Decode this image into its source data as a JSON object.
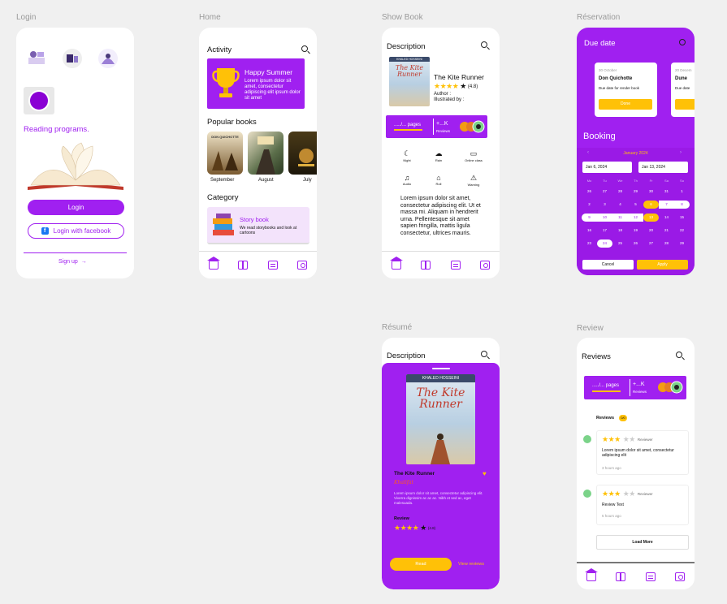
{
  "labels": {
    "login": "Login",
    "home": "Home",
    "show_book": "Show Book",
    "reservation": "Réservation",
    "resume": "Résumé",
    "review": "Review"
  },
  "login_screen": {
    "reading_programs": "Reading programs.",
    "login_button": "Login",
    "facebook_button": "Login with facebook",
    "signup": "Sign up"
  },
  "home_screen": {
    "activity": "Activity",
    "banner_title": "Happy Summer",
    "banner_text": "Lorem ipsum dolor sit amet, consectetur adipiscing elit ipsum dolor sit amet",
    "popular": "Popular books",
    "books": [
      {
        "month": "September",
        "cover": "DON QUICHOTTE"
      },
      {
        "month": "August",
        "cover": ""
      },
      {
        "month": "July",
        "cover": ""
      }
    ],
    "category": "Category",
    "category_title": "Story book",
    "category_text": "We read storybooks and look at cartoons"
  },
  "show_book": {
    "description": "Description",
    "cover_author": "KHALED HOSSEINI",
    "cover_title": "The Kite Runner",
    "title": "The Kite Runner",
    "rating": "(4.8)",
    "author": "Author :",
    "illustrated": "Illustrated by :",
    "pages": "...../... pages",
    "reviews_count": "+...K",
    "reviews_label": "Reviews",
    "features": [
      {
        "icon": "night-icon",
        "label": "Night"
      },
      {
        "icon": "rain-icon",
        "label": "Rain"
      },
      {
        "icon": "laptop-icon",
        "label": "Online class"
      },
      {
        "icon": "audio-icon",
        "label": "Audio"
      },
      {
        "icon": "building-icon",
        "label": "Roll"
      },
      {
        "icon": "warning-icon",
        "label": "Warning"
      }
    ],
    "body": "Lorem ipsum dolor sit amet, consectetur adipiscing elit. Ut et massa mi. Aliquam in hendrerit urna. Pellentesque sit amet sapien fringilla, mattis ligula consectetur, ultrices mauris."
  },
  "reservation": {
    "due_date": "Due date",
    "cards": [
      {
        "date": "30 October",
        "title": "Don Quichotte",
        "sub": "Due date for render book",
        "button": "Done"
      },
      {
        "date": "20 Decem",
        "title": "Dune",
        "sub": "Due date",
        "button": ""
      }
    ],
    "booking": "Booking",
    "month": "January 2024",
    "from": "Jan 6, 2024",
    "to": "Jan 13, 2024",
    "weekdays": [
      "Mo",
      "Tu",
      "We",
      "Th",
      "Fr",
      "Sa",
      "Su"
    ],
    "weeks": [
      [
        "26",
        "27",
        "28",
        "29",
        "30",
        "31",
        "1"
      ],
      [
        "2",
        "3",
        "4",
        "5",
        "6",
        "7",
        "8"
      ],
      [
        "9",
        "10",
        "11",
        "12",
        "13",
        "14",
        "15"
      ],
      [
        "16",
        "17",
        "18",
        "19",
        "20",
        "21",
        "22"
      ],
      [
        "23",
        "24",
        "25",
        "26",
        "27",
        "28",
        "29"
      ]
    ],
    "cancel": "Cancel",
    "apply": "Apply"
  },
  "resume": {
    "description": "Description",
    "cover_author": "KHALED HOSSEINI",
    "cover_title": "The Kite Runner",
    "title": "The Kite Runner",
    "author_tag": "Khalifat",
    "body": "Lorem ipsum dolor sit amet, consectetur adipiscing elit. Viverra dignissim ac ac ac. Nibh et sed ac, eget malesuada.",
    "review": "Review",
    "rating": "(4.8)",
    "read": "Read",
    "view_reviews": "View reviews"
  },
  "review_screen": {
    "reviews": "Reviews",
    "pages": "...../... pages",
    "reviews_count": "+...K",
    "reviews_label": "Reviews",
    "count_label": "Reviews",
    "count_badge": "0/0",
    "items": [
      {
        "reviewer": "Reviewer",
        "text": "Lorem ipsum dolor sit amet, consectetur adipiscing elit",
        "time": "3 hours ago"
      },
      {
        "reviewer": "Reviewer",
        "text": "Review Text",
        "time": "5 hours ago"
      }
    ],
    "load_more": "Load More"
  },
  "colors": {
    "purple": "#a020f0",
    "yellow": "#ffc107"
  }
}
